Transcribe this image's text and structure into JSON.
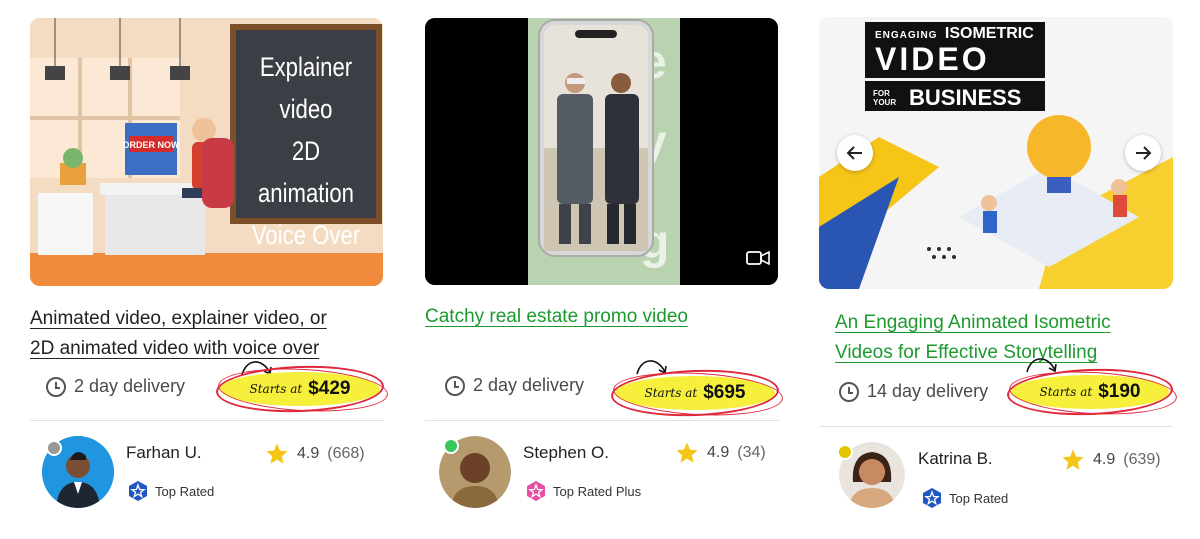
{
  "cards": [
    {
      "thumb_text": [
        "Explainer video",
        "2D animation",
        "Voice Over"
      ],
      "sign_text": "ORDER NOW",
      "title_line1": "Animated video, explainer video, or",
      "title_line2": "2D animated video with voice over",
      "title_color": "#222222",
      "delivery": "2 day delivery",
      "starts_label": "Starts at",
      "price": "$429",
      "seller": "Farhan U.",
      "status_color": "#999999",
      "badge": "Top Rated",
      "badge_color": "#1f57c3",
      "rating": "4.9",
      "reviews": "(668)"
    },
    {
      "title_line1": "Catchy real estate promo video",
      "title_color": "#1c9a2e",
      "delivery": "2 day delivery",
      "starts_label": "Starts at",
      "price": "$695",
      "seller": "Stephen O.",
      "status_color": "#35c85a",
      "badge": "Top Rated Plus",
      "badge_color": "#e64fa3",
      "rating": "4.9",
      "reviews": "(34)",
      "video_icon": "video-camera-icon"
    },
    {
      "thumb_small": "ENGAGING",
      "thumb_text": [
        "ISOMETRIC",
        "VIDEO",
        "FOR YOUR",
        "BUSINESS"
      ],
      "title_line1": "An Engaging Animated Isometric",
      "title_line2": "Videos for Effective Storytelling",
      "title_color": "#1c9a2e",
      "delivery": "14 day delivery",
      "starts_label": "Starts at",
      "price": "$190",
      "seller": "Katrina B.",
      "status_color": "#e3c400",
      "badge": "Top Rated",
      "badge_color": "#1f57c3",
      "rating": "4.9",
      "reviews": "(639)",
      "prev_icon": "arrow-left-icon",
      "next_icon": "arrow-right-icon"
    }
  ],
  "star_color": "#f5c518"
}
